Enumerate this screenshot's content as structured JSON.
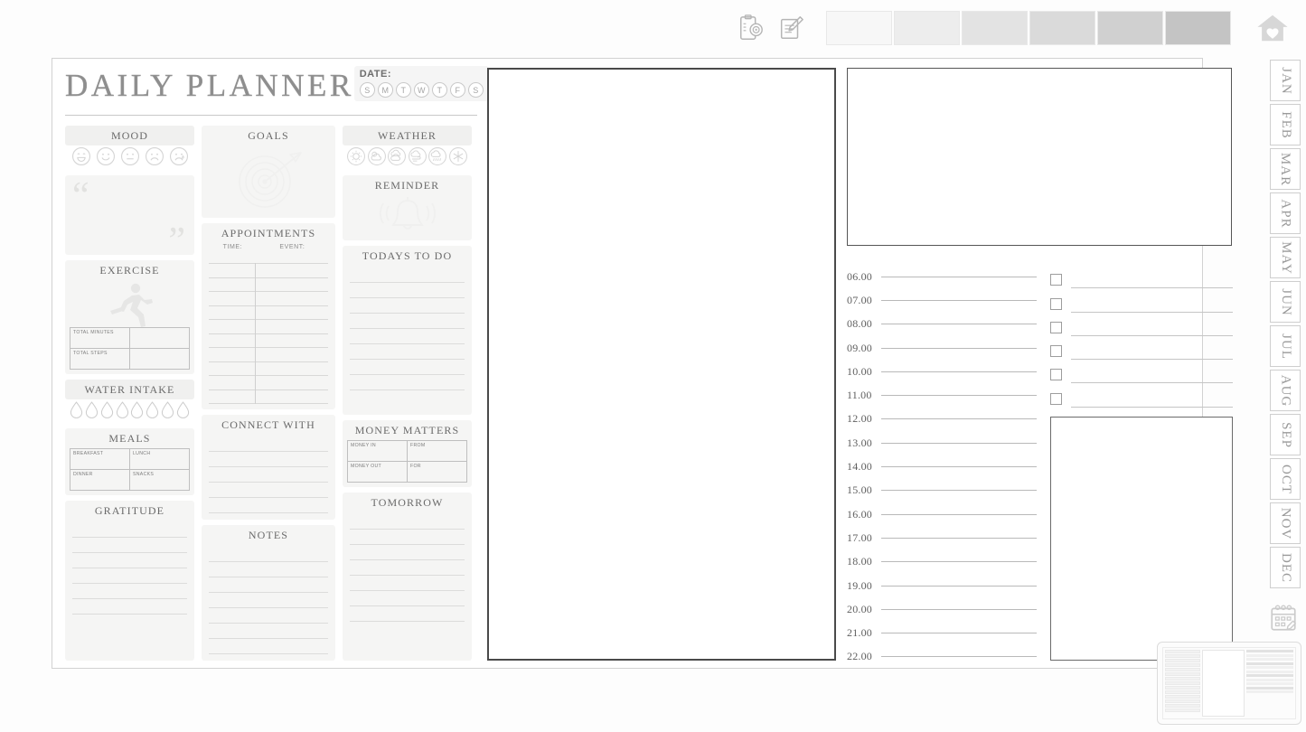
{
  "toolbar": {
    "icons": [
      {
        "name": "goal-clipboard-icon",
        "label": "Goals"
      },
      {
        "name": "notepad-pencil-icon",
        "label": "Notes"
      }
    ],
    "swatches": [
      "#f7f7f7",
      "#ededed",
      "#e3e3e3",
      "#dadada",
      "#d0d0d0",
      "#c4c4c4"
    ],
    "home_label": "Home"
  },
  "months": [
    "JAN",
    "FEB",
    "MAR",
    "APR",
    "MAY",
    "JUN",
    "JUL",
    "AUG",
    "SEP",
    "OCT",
    "NOV",
    "DEC"
  ],
  "header": {
    "title": "DAILY PLANNER",
    "date_label": "DATE:",
    "days": [
      "S",
      "M",
      "T",
      "W",
      "T",
      "F",
      "S"
    ]
  },
  "cards": {
    "mood": {
      "title": "MOOD",
      "icons": [
        "mood-very-happy-icon",
        "mood-happy-icon",
        "mood-neutral-icon",
        "mood-sad-icon",
        "mood-crying-icon"
      ]
    },
    "quote": {
      "open": "“",
      "close": "”"
    },
    "exercise": {
      "title": "EXERCISE",
      "rows": [
        {
          "label": "TOTAL MINUTES",
          "value": ""
        },
        {
          "label": "TOTAL STEPS",
          "value": ""
        }
      ]
    },
    "water": {
      "title": "WATER INTAKE",
      "drops": 8
    },
    "meals": {
      "title": "MEALS",
      "cells": [
        {
          "label": "BREAKFAST",
          "value": ""
        },
        {
          "label": "LUNCH",
          "value": ""
        },
        {
          "label": "DINNER",
          "value": ""
        },
        {
          "label": "SNACKS",
          "value": ""
        }
      ]
    },
    "gratitude": {
      "title": "GRATITUDE",
      "lines": 6
    },
    "goals": {
      "title": "GOALS",
      "illustration": "target-arrow-icon"
    },
    "appointments": {
      "title": "APPOINTMENTS",
      "col_time": "TIME:",
      "col_event": "EVENT:",
      "rows": 11
    },
    "connect": {
      "title": "CONNECT WITH",
      "lines": 5
    },
    "notes": {
      "title": "NOTES",
      "lines": 7
    },
    "weather": {
      "title": "WEATHER",
      "icons": [
        "weather-sunny-icon",
        "weather-partly-cloudy-icon",
        "weather-cloudy-icon",
        "weather-windy-icon",
        "weather-rain-icon",
        "weather-snow-icon"
      ]
    },
    "reminder": {
      "title": "REMINDER",
      "illustration": "bell-icon"
    },
    "todo": {
      "title": "TODAYS TO DO",
      "lines": 8
    },
    "money": {
      "title": "MONEY MATTERS",
      "cells": [
        {
          "label": "MONEY IN",
          "value": ""
        },
        {
          "label": "FROM",
          "value": ""
        },
        {
          "label": "MONEY OUT",
          "value": ""
        },
        {
          "label": "FOR",
          "value": ""
        }
      ]
    },
    "tomorrow": {
      "title": "TOMORROW",
      "lines": 7
    }
  },
  "schedule": {
    "hours": [
      "06.00",
      "07.00",
      "08.00",
      "09.00",
      "10.00",
      "11.00",
      "12.00",
      "13.00",
      "14.00",
      "15.00",
      "16.00",
      "17.00",
      "18.00",
      "19.00",
      "20.00",
      "21.00",
      "22.00"
    ],
    "checkbox_rows": 6
  },
  "preview": {
    "label": "page-thumbnail"
  }
}
